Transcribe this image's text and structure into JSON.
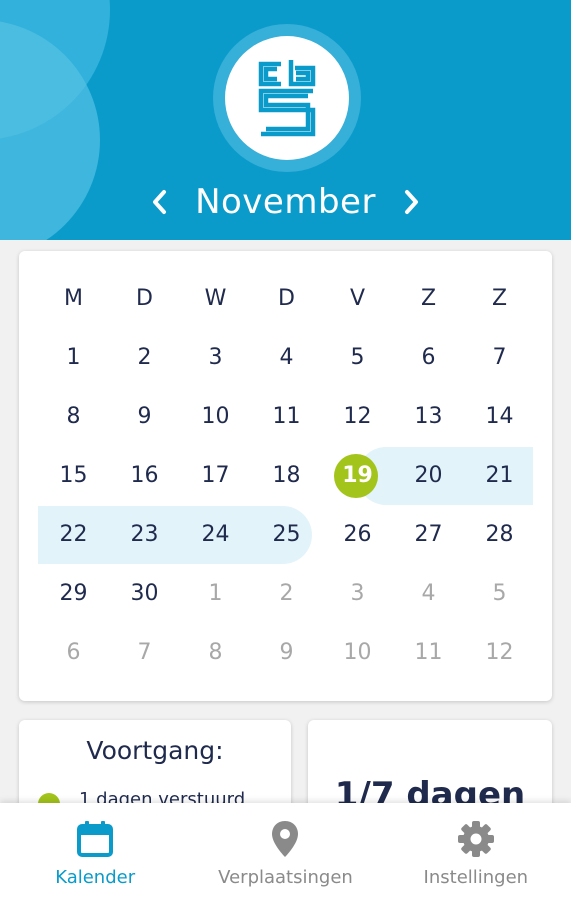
{
  "header": {
    "month": "November",
    "prev_icon": "chevron-left-icon",
    "next_icon": "chevron-right-icon",
    "logo": "cbs-logo",
    "colors": {
      "header_bg": "#0a9bcb",
      "accent_green": "#a3c41a",
      "highlight": "#e3f3fa"
    }
  },
  "calendar": {
    "weekdays": [
      "M",
      "D",
      "W",
      "D",
      "V",
      "Z",
      "Z"
    ],
    "weeks": [
      [
        {
          "d": "1",
          "m": false
        },
        {
          "d": "2",
          "m": false
        },
        {
          "d": "3",
          "m": false
        },
        {
          "d": "4",
          "m": false
        },
        {
          "d": "5",
          "m": false
        },
        {
          "d": "6",
          "m": false
        },
        {
          "d": "7",
          "m": false
        }
      ],
      [
        {
          "d": "8",
          "m": false
        },
        {
          "d": "9",
          "m": false
        },
        {
          "d": "10",
          "m": false
        },
        {
          "d": "11",
          "m": false
        },
        {
          "d": "12",
          "m": false
        },
        {
          "d": "13",
          "m": false
        },
        {
          "d": "14",
          "m": false
        }
      ],
      [
        {
          "d": "15",
          "m": false
        },
        {
          "d": "16",
          "m": false
        },
        {
          "d": "17",
          "m": false
        },
        {
          "d": "18",
          "m": false
        },
        {
          "d": "19",
          "m": false,
          "today": true
        },
        {
          "d": "20",
          "m": false
        },
        {
          "d": "21",
          "m": false
        }
      ],
      [
        {
          "d": "22",
          "m": false
        },
        {
          "d": "23",
          "m": false
        },
        {
          "d": "24",
          "m": false
        },
        {
          "d": "25",
          "m": false
        },
        {
          "d": "26",
          "m": false
        },
        {
          "d": "27",
          "m": false
        },
        {
          "d": "28",
          "m": false
        }
      ],
      [
        {
          "d": "29",
          "m": false
        },
        {
          "d": "30",
          "m": false
        },
        {
          "d": "1",
          "m": true
        },
        {
          "d": "2",
          "m": true
        },
        {
          "d": "3",
          "m": true
        },
        {
          "d": "4",
          "m": true
        },
        {
          "d": "5",
          "m": true
        }
      ],
      [
        {
          "d": "6",
          "m": true
        },
        {
          "d": "7",
          "m": true
        },
        {
          "d": "8",
          "m": true
        },
        {
          "d": "9",
          "m": true
        },
        {
          "d": "10",
          "m": true
        },
        {
          "d": "11",
          "m": true
        },
        {
          "d": "12",
          "m": true
        }
      ]
    ]
  },
  "progress": {
    "title": "Voortgang:",
    "legend_sent": "1 dagen verstuurd",
    "count": "1/7 dagen"
  },
  "nav": {
    "items": [
      {
        "label": "Kalender",
        "icon": "calendar-icon",
        "active": true
      },
      {
        "label": "Verplaatsingen",
        "icon": "location-pin-icon",
        "active": false
      },
      {
        "label": "Instellingen",
        "icon": "gear-icon",
        "active": false
      }
    ]
  }
}
